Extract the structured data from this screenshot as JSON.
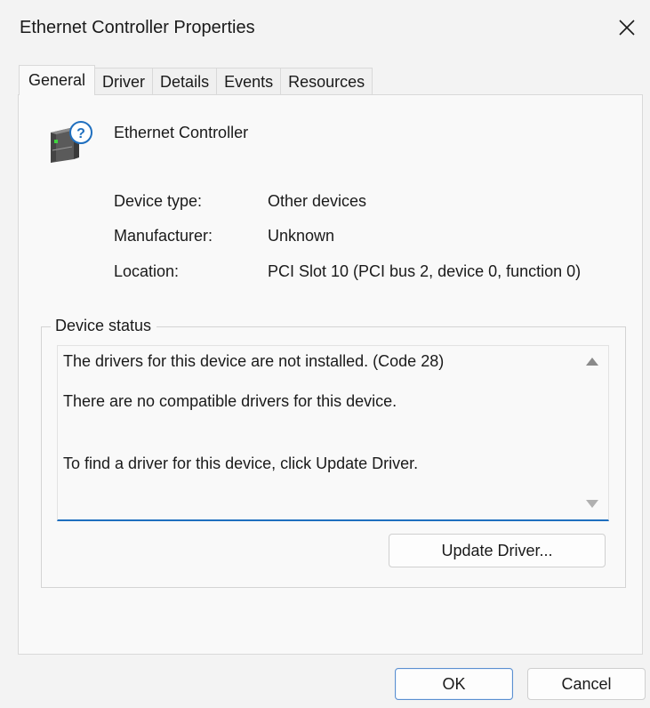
{
  "window": {
    "title": "Ethernet Controller Properties"
  },
  "tabs": [
    {
      "label": "General",
      "active": true
    },
    {
      "label": "Driver",
      "active": false
    },
    {
      "label": "Details",
      "active": false
    },
    {
      "label": "Events",
      "active": false
    },
    {
      "label": "Resources",
      "active": false
    }
  ],
  "device": {
    "name": "Ethernet Controller",
    "icon": "unknown-device-icon"
  },
  "properties": {
    "device_type_label": "Device type:",
    "device_type_value": "Other devices",
    "manufacturer_label": "Manufacturer:",
    "manufacturer_value": "Unknown",
    "location_label": "Location:",
    "location_value": "PCI Slot 10 (PCI bus 2, device 0, function 0)"
  },
  "status": {
    "group_label": "Device status",
    "line1": "The drivers for this device are not installed. (Code 28)",
    "line2": "There are no compatible drivers for this device.",
    "line3": "To find a driver for this device, click Update Driver."
  },
  "buttons": {
    "update_driver": "Update Driver...",
    "ok": "OK",
    "cancel": "Cancel"
  },
  "colors": {
    "accent": "#1f6fbf",
    "icon_question": "#1f6fbf"
  }
}
